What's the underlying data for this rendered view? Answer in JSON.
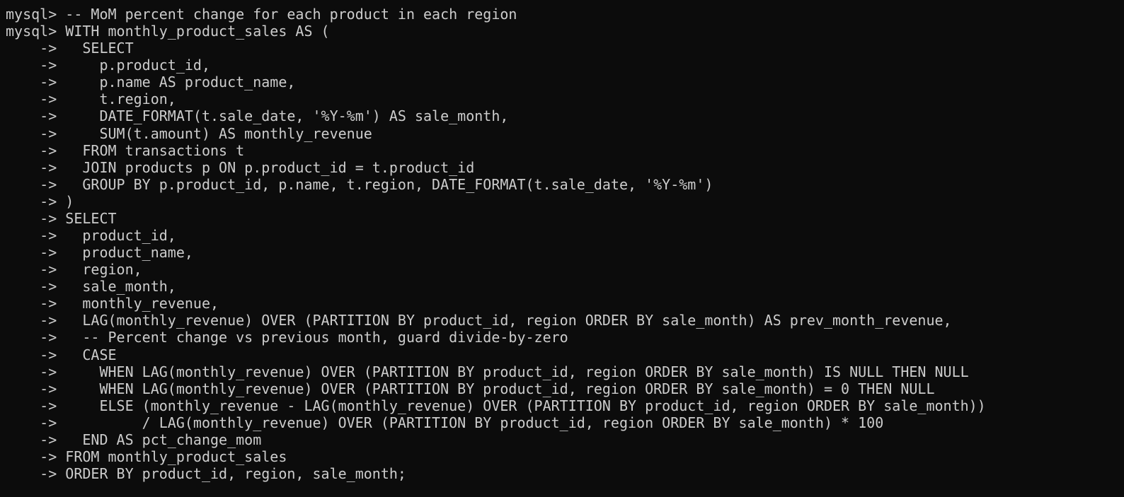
{
  "terminal": {
    "lines": [
      {
        "prompt": "mysql> ",
        "text": "-- MoM percent change for each product in each region"
      },
      {
        "prompt": "mysql> ",
        "text": "WITH monthly_product_sales AS ("
      },
      {
        "prompt": "    -> ",
        "text": "  SELECT"
      },
      {
        "prompt": "    -> ",
        "text": "    p.product_id,"
      },
      {
        "prompt": "    -> ",
        "text": "    p.name AS product_name,"
      },
      {
        "prompt": "    -> ",
        "text": "    t.region,"
      },
      {
        "prompt": "    -> ",
        "text": "    DATE_FORMAT(t.sale_date, '%Y-%m') AS sale_month,"
      },
      {
        "prompt": "    -> ",
        "text": "    SUM(t.amount) AS monthly_revenue"
      },
      {
        "prompt": "    -> ",
        "text": "  FROM transactions t"
      },
      {
        "prompt": "    -> ",
        "text": "  JOIN products p ON p.product_id = t.product_id"
      },
      {
        "prompt": "    -> ",
        "text": "  GROUP BY p.product_id, p.name, t.region, DATE_FORMAT(t.sale_date, '%Y-%m')"
      },
      {
        "prompt": "    -> ",
        "text": ")"
      },
      {
        "prompt": "    -> ",
        "text": "SELECT"
      },
      {
        "prompt": "    -> ",
        "text": "  product_id,"
      },
      {
        "prompt": "    -> ",
        "text": "  product_name,"
      },
      {
        "prompt": "    -> ",
        "text": "  region,"
      },
      {
        "prompt": "    -> ",
        "text": "  sale_month,"
      },
      {
        "prompt": "    -> ",
        "text": "  monthly_revenue,"
      },
      {
        "prompt": "    -> ",
        "text": "  LAG(monthly_revenue) OVER (PARTITION BY product_id, region ORDER BY sale_month) AS prev_month_revenue,"
      },
      {
        "prompt": "    -> ",
        "text": "  -- Percent change vs previous month, guard divide-by-zero"
      },
      {
        "prompt": "    -> ",
        "text": "  CASE"
      },
      {
        "prompt": "    -> ",
        "text": "    WHEN LAG(monthly_revenue) OVER (PARTITION BY product_id, region ORDER BY sale_month) IS NULL THEN NULL"
      },
      {
        "prompt": "    -> ",
        "text": "    WHEN LAG(monthly_revenue) OVER (PARTITION BY product_id, region ORDER BY sale_month) = 0 THEN NULL"
      },
      {
        "prompt": "    -> ",
        "text": "    ELSE (monthly_revenue - LAG(monthly_revenue) OVER (PARTITION BY product_id, region ORDER BY sale_month))"
      },
      {
        "prompt": "    -> ",
        "text": "         / LAG(monthly_revenue) OVER (PARTITION BY product_id, region ORDER BY sale_month) * 100"
      },
      {
        "prompt": "    -> ",
        "text": "  END AS pct_change_mom"
      },
      {
        "prompt": "    -> ",
        "text": "FROM monthly_product_sales"
      },
      {
        "prompt": "    -> ",
        "text": "ORDER BY product_id, region, sale_month;"
      }
    ]
  }
}
